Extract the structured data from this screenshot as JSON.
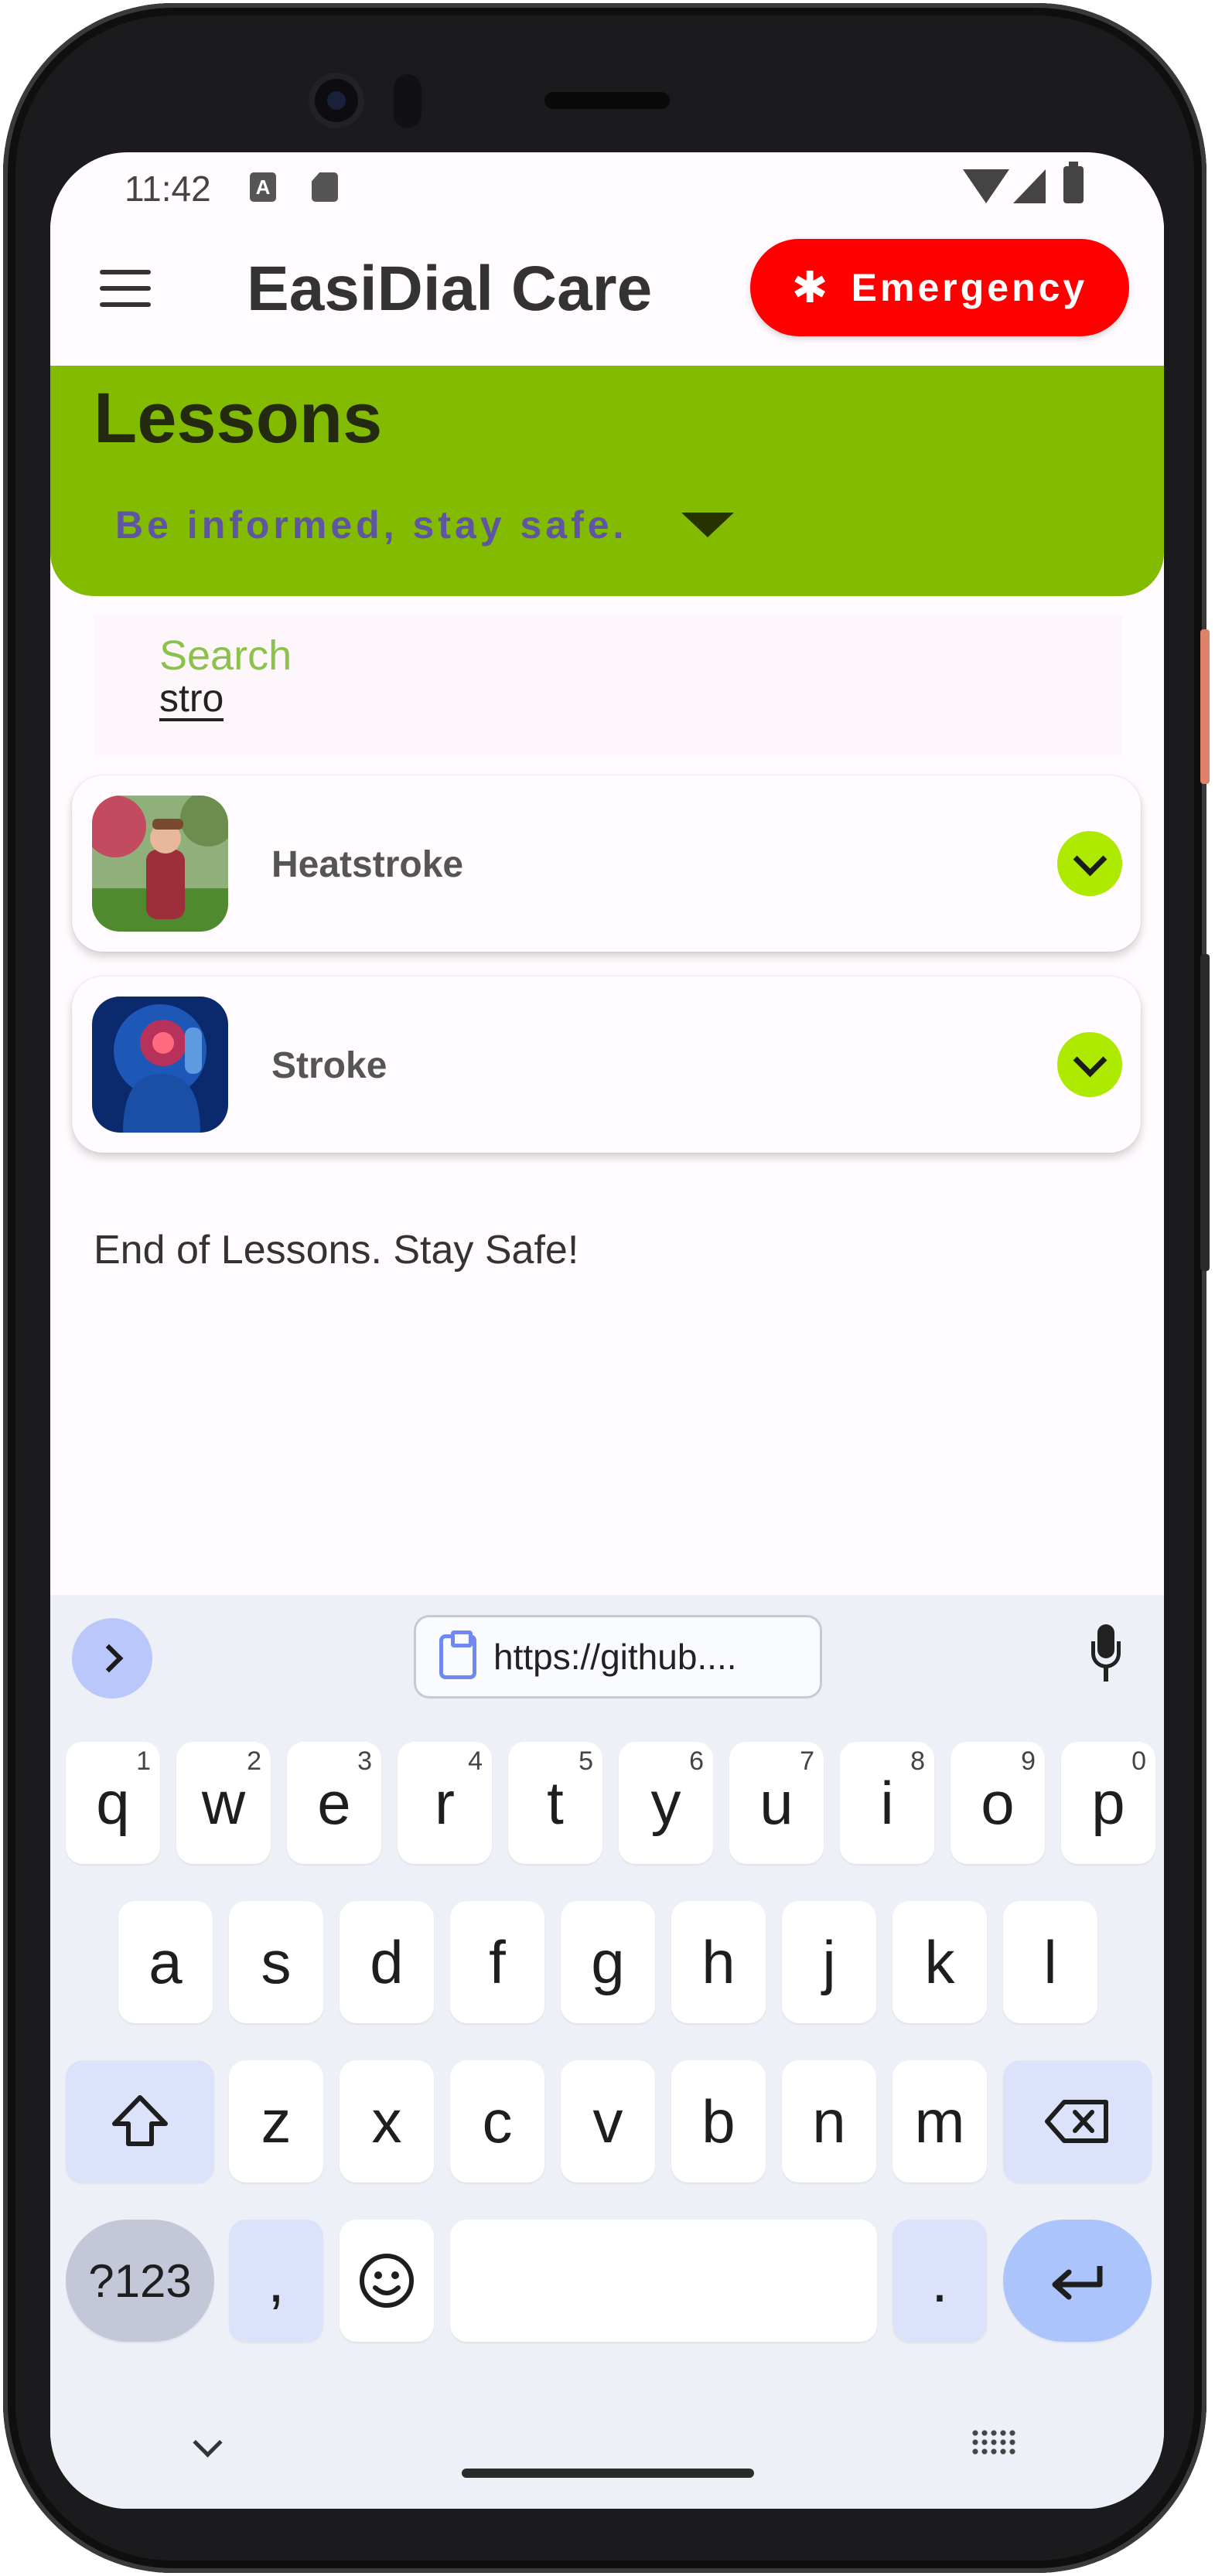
{
  "status_bar": {
    "time": "11:42",
    "notif_a": "A"
  },
  "app_bar": {
    "title": "EasiDial Care",
    "emergency_label": "Emergency",
    "emergency_color": "#ff0000"
  },
  "header": {
    "title": "Lessons",
    "tagline": "Be informed, stay safe.",
    "band_color": "#83bb00"
  },
  "search": {
    "label": "Search",
    "value": "stro"
  },
  "lessons": [
    {
      "name": "Heatstroke",
      "thumb": "woman-in-heat-photo"
    },
    {
      "name": "Stroke",
      "thumb": "brain-xray-photo"
    }
  ],
  "end_message": "End of Lessons. Stay Safe!",
  "keyboard": {
    "clipboard_text": "https://github....",
    "row1": [
      {
        "k": "q",
        "h": "1"
      },
      {
        "k": "w",
        "h": "2"
      },
      {
        "k": "e",
        "h": "3"
      },
      {
        "k": "r",
        "h": "4"
      },
      {
        "k": "t",
        "h": "5"
      },
      {
        "k": "y",
        "h": "6"
      },
      {
        "k": "u",
        "h": "7"
      },
      {
        "k": "i",
        "h": "8"
      },
      {
        "k": "o",
        "h": "9"
      },
      {
        "k": "p",
        "h": "0"
      }
    ],
    "row2": [
      "a",
      "s",
      "d",
      "f",
      "g",
      "h",
      "j",
      "k",
      "l"
    ],
    "row3": [
      "z",
      "x",
      "c",
      "v",
      "b",
      "n",
      "m"
    ],
    "symbols_label": "?123",
    "comma": ",",
    "period": "."
  }
}
